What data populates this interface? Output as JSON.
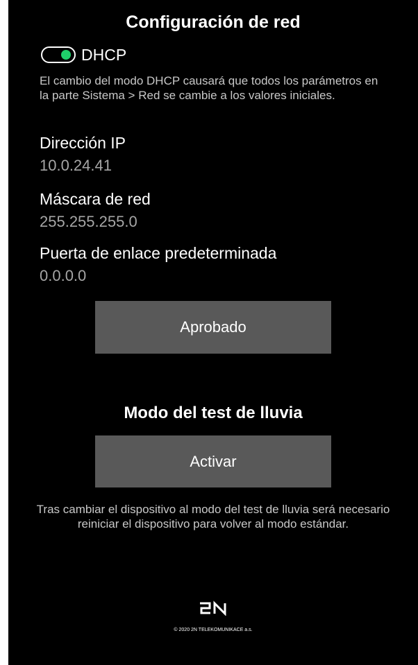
{
  "network": {
    "title": "Configuración de red",
    "dhcp": {
      "label": "DHCP",
      "enabled": true,
      "toggle_color": "#1fcf6a"
    },
    "description": "El cambio del modo DHCP causará que todos los parámetros en la parte Sistema > Red se cambie a los valores iniciales.",
    "ip_label": "Dirección IP",
    "ip_value": "10.0.24.41",
    "mask_label": "Máscara de red",
    "mask_value": "255.255.255.0",
    "gateway_label": "Puerta de enlace predeterminada",
    "gateway_value": "0.0.0.0",
    "approve_button": "Aprobado"
  },
  "rain_test": {
    "title": "Modo del test de lluvia",
    "activate_button": "Activar",
    "note": "Tras cambiar el dispositivo al modo del test de lluvia será necesario reiniciar el dispositivo para volver al modo estándar."
  },
  "footer": {
    "logo": "2N",
    "copyright": "© 2020 2N TELEKOMUNIKACE a.s."
  },
  "colors": {
    "background": "#000000",
    "button": "#595959",
    "accent": "#1fcf6a"
  }
}
